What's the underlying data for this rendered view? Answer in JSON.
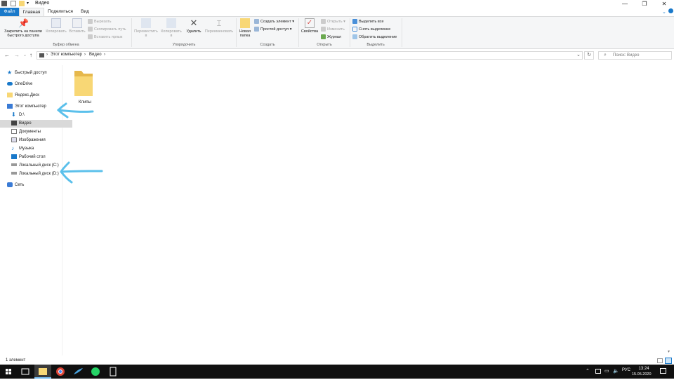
{
  "window": {
    "title": "Видео",
    "minimize": "—",
    "maximize": "❐",
    "close": "✕"
  },
  "tabs": {
    "file": "Файл",
    "home": "Главная",
    "share": "Поделиться",
    "view": "Вид"
  },
  "ribbon": {
    "clipboard": {
      "pin": "Закрепить на панели быстрого доступа",
      "copy": "Копировать",
      "paste": "Вставить",
      "cut": "Вырезать",
      "copy_path": "Скопировать путь",
      "paste_shortcut": "Вставить ярлык",
      "label": "Буфер обмена"
    },
    "organize": {
      "move": "Переместить в",
      "copyto": "Копировать в",
      "delete": "Удалить",
      "rename": "Переименовать",
      "label": "Упорядочить"
    },
    "create": {
      "new_folder": "Новая папка",
      "new_item": "Создать элемент",
      "easy_access": "Простой доступ",
      "label": "Создать"
    },
    "open": {
      "properties": "Свойства",
      "open": "Открыть",
      "edit": "Изменить",
      "history": "Журнал",
      "label": "Открыть"
    },
    "select": {
      "select_all": "Выделить все",
      "select_none": "Снять выделение",
      "invert": "Обратить выделение",
      "label": "Выделить"
    }
  },
  "nav": {
    "back": "←",
    "forward": "→",
    "recent": "⌄",
    "up": "↑",
    "breadcrumb": [
      "Этот компьютер",
      "Видео"
    ],
    "refresh": "↻",
    "search_placeholder": "Поиск: Видео"
  },
  "sidebar": {
    "items": [
      {
        "label": "Быстрый доступ"
      },
      {
        "label": "OneDrive"
      },
      {
        "label": "Яндекс.Диск"
      },
      {
        "label": "Этот компьютер"
      },
      {
        "label": "D:\\"
      },
      {
        "label": "Видео"
      },
      {
        "label": "Документы"
      },
      {
        "label": "Изображения"
      },
      {
        "label": "Музыка"
      },
      {
        "label": "Рабочий стол"
      },
      {
        "label": "Локальный диск (C:)"
      },
      {
        "label": "Локальный диск (D:)"
      },
      {
        "label": "Сеть"
      }
    ]
  },
  "content": {
    "items": [
      {
        "label": "Клипы"
      }
    ]
  },
  "status": {
    "count": "1 элемент"
  },
  "taskbar": {
    "lang": "РУС",
    "time": "13:24",
    "date": "15.05.2020"
  },
  "colors": {
    "accent": "#1979ca",
    "folder": "#f8d775",
    "annotation": "#5bc0eb"
  }
}
